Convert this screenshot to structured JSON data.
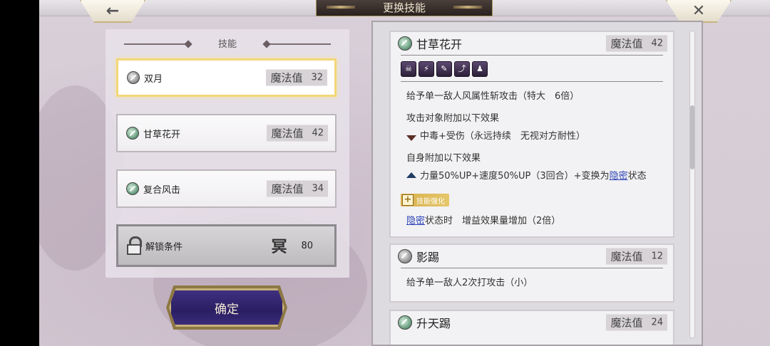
{
  "header": {
    "title": "更换技能",
    "back_glyph": "←",
    "close_glyph": "✕"
  },
  "left": {
    "section_title": "技能",
    "skills": [
      {
        "name": "双月",
        "mp_label": "魔法值",
        "mp": "32",
        "icon": "wind-skill-icon",
        "selected": true
      },
      {
        "name": "甘草花开",
        "mp_label": "魔法值",
        "mp": "42",
        "icon": "wind-skill-icon",
        "selected": false
      },
      {
        "name": "复合风击",
        "mp_label": "魔法值",
        "mp": "34",
        "icon": "wind-skill-icon",
        "selected": false
      }
    ],
    "locked": {
      "label": "解锁条件",
      "glyph": "冥",
      "value": "80"
    },
    "confirm_label": "确定"
  },
  "right": {
    "details": [
      {
        "name": "甘草花开",
        "mp_label": "魔法值",
        "mp": "42",
        "tags": [
          "☠",
          "⚡",
          "✎",
          "⤴",
          "♟"
        ],
        "desc": "给予单一敌人风属性斩攻击（特大　6倍）",
        "target_header": "攻击对象附加以下效果",
        "target_effect": "中毒+受伤（永远持续　无视对方耐性）",
        "self_header": "自身附加以下效果",
        "self_effect_a": "力量50%UP+速度50%UP（3回合）+变换为",
        "self_effect_link": "隐密",
        "self_effect_b": "状态",
        "enhance_label": "技能强化",
        "enhance_link": "隐密",
        "enhance_text": "状态时　增益效果量增加（2倍）"
      },
      {
        "name": "影踢",
        "mp_label": "魔法值",
        "mp": "12",
        "desc": "给予单一敌人2次打攻击（小）"
      },
      {
        "name": "升天踢",
        "mp_label": "魔法值",
        "mp": "24"
      }
    ]
  }
}
